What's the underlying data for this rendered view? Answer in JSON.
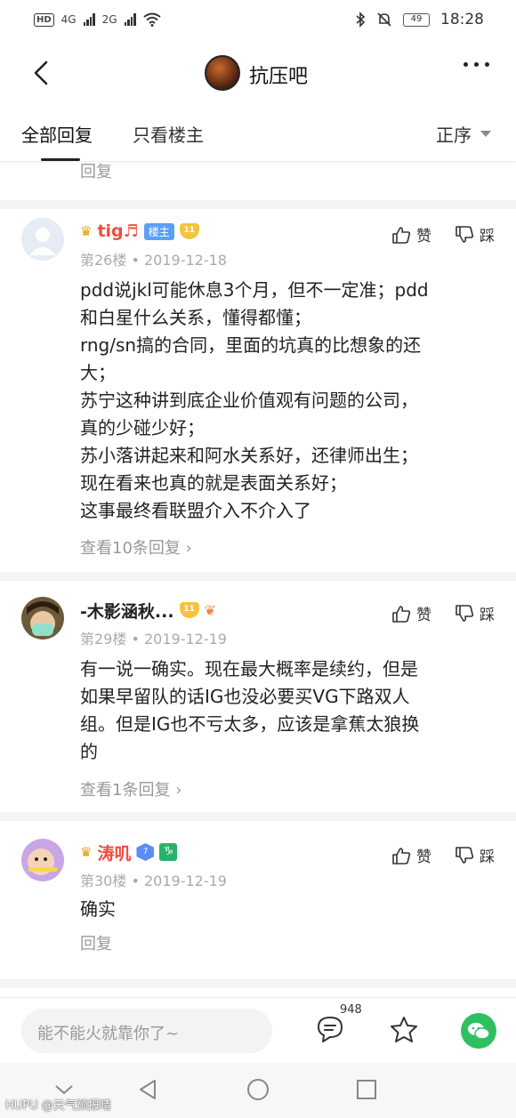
{
  "status_bar": {
    "network_1": "4G",
    "network_2": "2G",
    "battery": "49",
    "time": "18:28"
  },
  "header": {
    "group_name": "抗压吧"
  },
  "tabs": {
    "all_replies": "全部回复",
    "owner_only": "只看楼主",
    "sort": "正序"
  },
  "top_reply_link": "回复",
  "posts": [
    {
      "username": "tig♬",
      "owner_badge": "楼主",
      "level": "11",
      "floor": "第26楼",
      "date": "2019-12-18",
      "like": "赞",
      "dislike": "踩",
      "lines": [
        "pdd说jkl可能休息3个月，但不一定准；pdd",
        "和白星什么关系，懂得都懂；",
        "rng/sn搞的合同，里面的坑真的比想象的还",
        "大；",
        "苏宁这种讲到底企业价值观有问题的公司，",
        "真的少碰少好；",
        "苏小落讲起来和阿水关系好，还律师出生；",
        "现在看来也真的就是表面关系好；",
        "这事最终看联盟介入不介入了"
      ],
      "replies_link": "查看10条回复"
    },
    {
      "username": "-木影涵秋...",
      "level": "11",
      "floor": "第29楼",
      "date": "2019-12-19",
      "like": "赞",
      "dislike": "踩",
      "lines": [
        "有一说一确实。现在最大概率是续约，但是",
        "如果早留队的话IG也没必要买VG下路双人",
        "组。但是IG也不亏太多，应该是拿蕉太狼换",
        "的"
      ],
      "replies_link": "查看1条回复"
    },
    {
      "username": "涛叽",
      "level": "7",
      "zodiac": "♑",
      "floor": "第30楼",
      "date": "2019-12-19",
      "like": "赞",
      "dislike": "踩",
      "lines": [
        "确实"
      ],
      "replies_link": "回复"
    }
  ],
  "input_bar": {
    "placeholder": "能不能火就靠你了~",
    "comment_count": "948"
  },
  "watermark": "HUPU @天气预报晴",
  "colors": {
    "accent_green": "#2ec060",
    "owner_badge_blue": "#5aa0f5",
    "gem_gold": "#f6c33c",
    "meta_gray": "#aaaaaa"
  }
}
